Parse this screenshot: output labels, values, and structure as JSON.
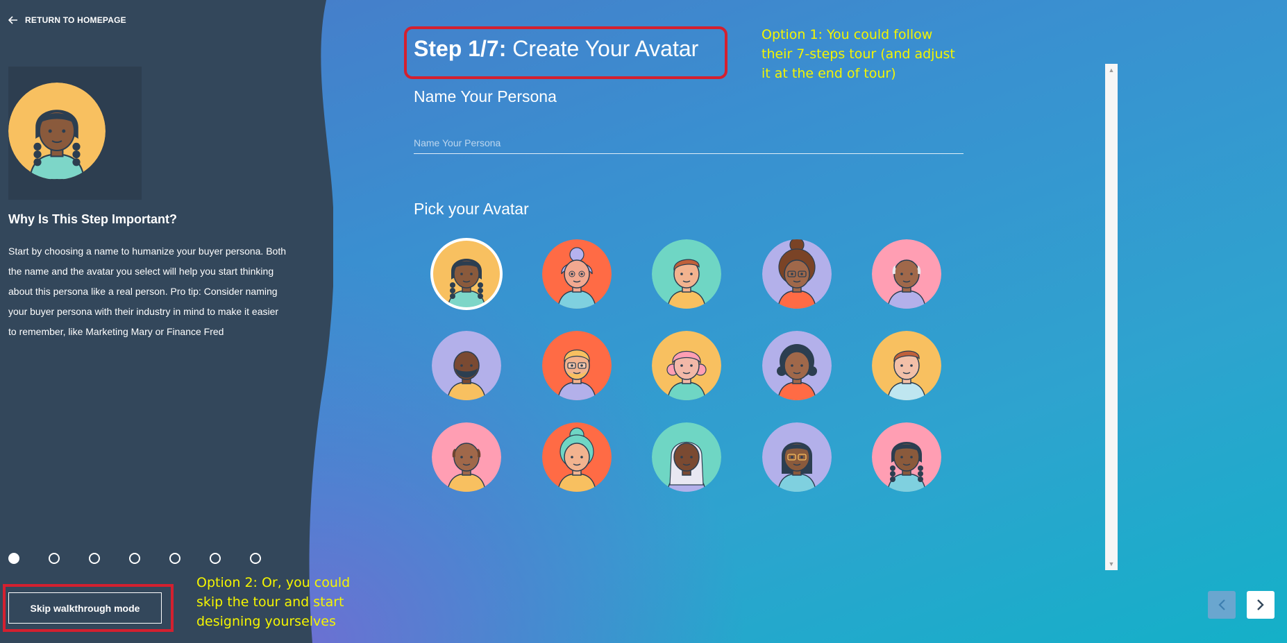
{
  "sidebar": {
    "back_label": "RETURN TO HOMEPAGE",
    "why_title": "Why Is This Step Important?",
    "why_text": "Start by choosing a name to humanize your buyer persona. Both the name and the avatar you select will help you start thinking about this persona like a real person. Pro tip: Consider naming your buyer persona with their industry in mind to make it easier to remember, like Marketing Mary or Finance Fred",
    "steps_total": 7,
    "current_step": 1,
    "skip_label": "Skip walkthrough mode"
  },
  "main": {
    "step_prefix": "Step 1/7:",
    "step_title": "Create Your Avatar",
    "name_label": "Name Your Persona",
    "name_placeholder": "Name Your Persona",
    "name_value": "",
    "avatar_label": "Pick your Avatar",
    "selected_avatar": 0
  },
  "annotations": {
    "option1": "Option 1: You could follow their 7-steps tour (and adjust it at the end of tour)",
    "option2": "Option 2: Or, you could skip the tour and start designing yourselves"
  },
  "avatars": [
    {
      "bg": "#f8c060",
      "skin": "#8a5a3c",
      "hair": "#2c3e50",
      "shirt": "#7dd6c8",
      "style": "braids"
    },
    {
      "bg": "#ff6b45",
      "skin": "#f2a890",
      "hair": "#b5b2ee",
      "shirt": "#7fd0df",
      "style": "bun-old"
    },
    {
      "bg": "#6fd6c4",
      "skin": "#f2b38f",
      "hair": "#c0603a",
      "shirt": "#f8c060",
      "style": "short"
    },
    {
      "bg": "#b3b0ea",
      "skin": "#a0684a",
      "hair": "#7a4326",
      "shirt": "#ff6b45",
      "style": "afro-bun-glasses"
    },
    {
      "bg": "#ff9eb3",
      "skin": "#a0684a",
      "hair": "#e8e8ee",
      "shirt": "#b3b0ea",
      "style": "bald"
    },
    {
      "bg": "#b3b0ea",
      "skin": "#7a4a32",
      "hair": "#2c3e50",
      "shirt": "#f8c060",
      "style": "beard"
    },
    {
      "bg": "#ff6b45",
      "skin": "#f2b38f",
      "hair": "#f8c060",
      "shirt": "#b3b0ea",
      "style": "glasses-beard"
    },
    {
      "bg": "#f8c060",
      "skin": "#f2b8a8",
      "hair": "#ff9eb3",
      "shirt": "#6fd6c4",
      "style": "pink-curls"
    },
    {
      "bg": "#b3b0ea",
      "skin": "#a0684a",
      "hair": "#2c3e50",
      "shirt": "#ff6b45",
      "style": "curly"
    },
    {
      "bg": "#f8c060",
      "skin": "#f2c0a8",
      "hair": "#c0603a",
      "shirt": "#bfe6f0",
      "style": "short"
    },
    {
      "bg": "#ff9eb3",
      "skin": "#a0684a",
      "hair": "#6d4530",
      "shirt": "#f8c060",
      "style": "bald"
    },
    {
      "bg": "#ff6b45",
      "skin": "#f2b38f",
      "hair": "#6fd6c4",
      "shirt": "#f8c060",
      "style": "curly-bun"
    },
    {
      "bg": "#6fd6c4",
      "skin": "#7a4a32",
      "hair": "#e8e8f2",
      "shirt": "#b3b0ea",
      "style": "long"
    },
    {
      "bg": "#b3b0ea",
      "skin": "#8a5a3c",
      "hair": "#2c3e50",
      "shirt": "#7fd0df",
      "style": "glasses-long"
    },
    {
      "bg": "#ff9eb3",
      "skin": "#8a5a3c",
      "hair": "#2c3e50",
      "shirt": "#7fd0df",
      "style": "braids"
    }
  ]
}
